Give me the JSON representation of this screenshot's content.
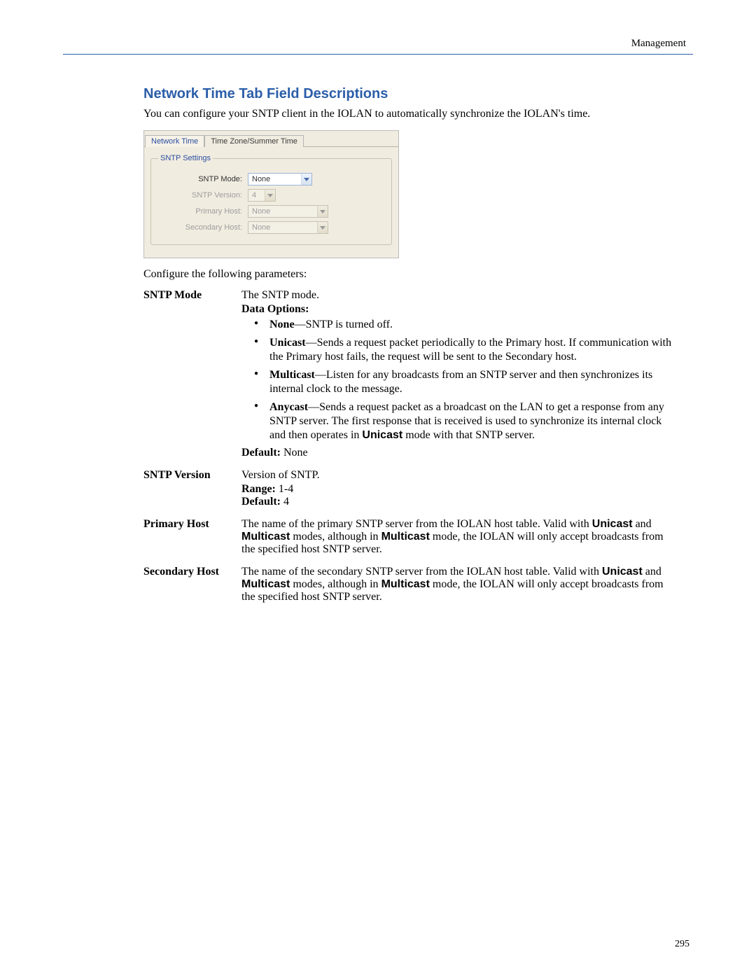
{
  "header": {
    "right": "Management"
  },
  "section": {
    "title": "Network Time Tab Field Descriptions",
    "intro": "You can configure your SNTP client in the IOLAN to automatically synchronize the IOLAN's time."
  },
  "ui": {
    "tabs": {
      "active": "Network Time",
      "inactive": "Time Zone/Summer Time"
    },
    "fieldset_title": "SNTP Settings",
    "mode_label": "SNTP Mode:",
    "mode_value": "None",
    "version_label": "SNTP Version:",
    "version_value": "4",
    "primary_label": "Primary Host:",
    "primary_value": "None",
    "secondary_label": "Secondary Host:",
    "secondary_value": "None"
  },
  "configure_line": "Configure the following parameters:",
  "params": {
    "sntp_mode": {
      "name": "SNTP Mode",
      "lead": "The SNTP mode.",
      "data_options_label": "Data Options:",
      "opt_none_b": "None",
      "opt_none_t": "—SNTP is turned off.",
      "opt_uni_b": "Unicast",
      "opt_uni_t": "—Sends a request packet periodically to the Primary host. If communication with the Primary host fails, the request will be sent to the Secondary host.",
      "opt_multi_b": "Multicast",
      "opt_multi_t": "—Listen for any broadcasts from an SNTP server and then synchronizes its internal clock to the message.",
      "opt_any_b": "Anycast",
      "opt_any_t1": "—Sends a request packet as a broadcast on the LAN to get a response from any SNTP server. The first response that is received is used to synchronize its internal clock and then operates in ",
      "opt_any_bold": "Unicast",
      "opt_any_t2": " mode with that SNTP server.",
      "default_label": "Default: ",
      "default_value": "None"
    },
    "sntp_version": {
      "name": "SNTP Version",
      "lead": "Version of SNTP.",
      "range_label": "Range: ",
      "range_value": "1-4",
      "default_label": "Default: ",
      "default_value": "4"
    },
    "primary_host": {
      "name": "Primary Host",
      "t1": "The name of the primary SNTP server from the IOLAN host table. Valid with ",
      "b1": "Unicast",
      "t2": " and ",
      "b2": "Multicast",
      "t3": " modes, although in ",
      "b3": "Multicast",
      "t4": " mode, the IOLAN will only accept broadcasts from the specified host SNTP server."
    },
    "secondary_host": {
      "name": "Secondary Host",
      "t1": "The name of the secondary SNTP server from the IOLAN host table. Valid with ",
      "b1": "Unicast",
      "t2": " and ",
      "b2": "Multicast",
      "t3": " modes, although in ",
      "b3": "Multicast",
      "t4": " mode, the IOLAN will only accept broadcasts from the specified host SNTP server."
    }
  },
  "page_number": "295"
}
